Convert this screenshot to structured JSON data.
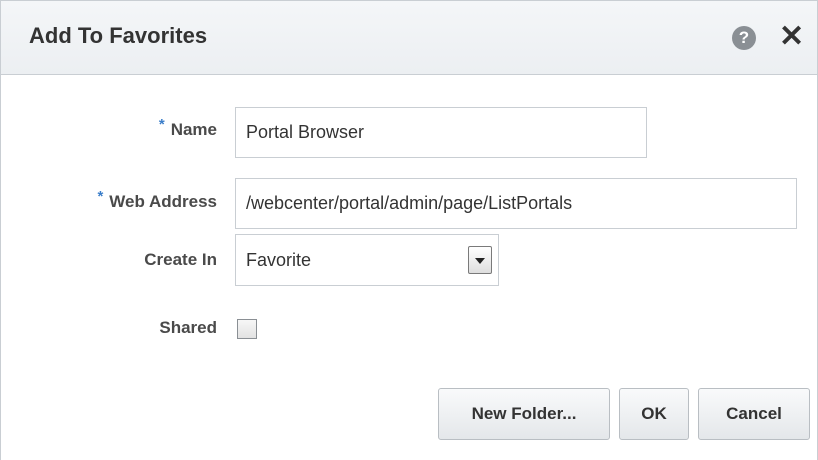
{
  "dialog": {
    "title": "Add To Favorites",
    "help_icon_glyph": "?",
    "close_icon_glyph": "✕"
  },
  "form": {
    "required_marker": "*",
    "name_label": "Name",
    "name_value": "Portal Browser",
    "web_address_label": "Web Address",
    "web_address_value": "/webcenter/portal/admin/page/ListPortals",
    "create_in_label": "Create In",
    "create_in_value": "Favorite",
    "shared_label": "Shared",
    "shared_checked": false
  },
  "buttons": {
    "new_folder": "New Folder...",
    "ok": "OK",
    "cancel": "Cancel"
  },
  "colors": {
    "required_marker": "#3a7dc9",
    "header_bg": "#eceff2",
    "text": "#333333"
  }
}
